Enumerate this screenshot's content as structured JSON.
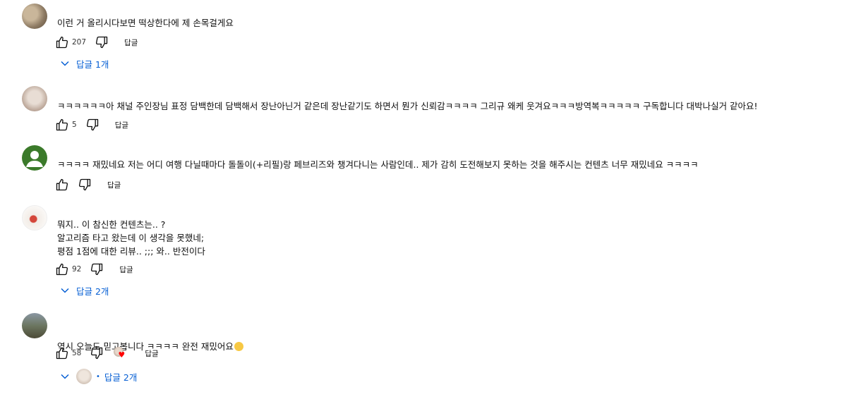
{
  "comments": [
    {
      "text": "이런 거 올리시다보면 떡상한다에 제 손목걸게요",
      "likes": "207",
      "reply_label": "답글",
      "replies_toggle": "답글 1개"
    },
    {
      "text": "ㅋㅋㅋㅋㅋㅋ아 채널 주인장님 표정 담백한데 담백해서 장난아닌거 같은데 장난같기도 하면서 뭔가 신뢰감ㅋㅋㅋㅋ 그리규 왜케 웃겨요ㅋㅋㅋ방역복ㅋㅋㅋㅋㅋ 구독합니다 대박나실거 같아요!",
      "likes": "5",
      "reply_label": "답글"
    },
    {
      "text": "ㅋㅋㅋㅋ 재밌네요 저는 어디 여행 다닐때마다 돌돌이(+리필)랑 페브리즈와 챙겨다니는 사람인데.. 제가 감히 도전해보지 못하는 것을 해주시는 컨텐츠 너무 재밌네요 ㅋㅋㅋㅋ",
      "likes": "",
      "reply_label": "답글",
      "avatar_color": "#3b7a2a"
    },
    {
      "text": "뭐지.. 이 참신한 컨텐츠는.. ?\n알고리즘 타고 왔는데 이 생각을 못했네;\n평점 1점에 대한 리뷰.. ;;; 와.. 반전이다",
      "likes": "92",
      "reply_label": "답글",
      "replies_toggle": "답글 2개"
    },
    {
      "text": "역시 오늘도 믿고봅니다 ㅋㅋㅋㅋ 완전 재밌어요",
      "likes": "58",
      "reply_label": "답글",
      "replies_toggle": "답글 2개"
    }
  ],
  "icons": {
    "like": "thumb-up-icon",
    "dislike": "thumb-down-icon",
    "chevron": "chevron-down-icon",
    "heart": "heart-icon",
    "emoji": "smiling-face-emoji"
  },
  "colors": {
    "link": "#065fd4",
    "heart": "#ff0000"
  }
}
